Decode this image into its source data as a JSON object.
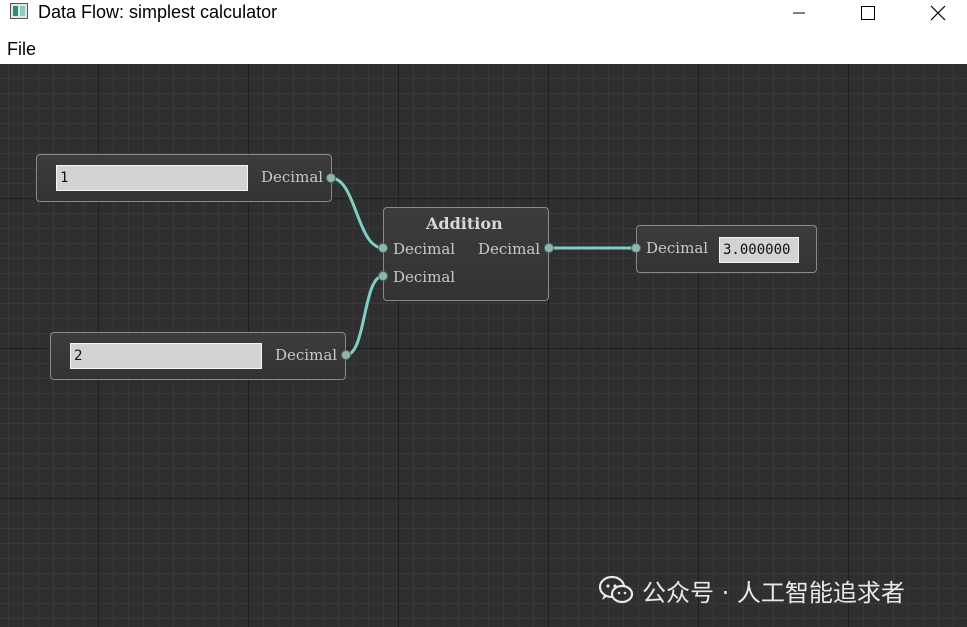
{
  "window": {
    "title": "Data Flow: simplest calculator",
    "icon": "app-window-icon"
  },
  "menu": {
    "file_label": "File"
  },
  "nodes": {
    "input1": {
      "value": "1",
      "out_port_label": "Decimal"
    },
    "input2": {
      "value": "2",
      "out_port_label": "Decimal"
    },
    "addition": {
      "title": "Addition",
      "in1_label": "Decimal",
      "in2_label": "Decimal",
      "out_label": "Decimal"
    },
    "result": {
      "in_port_label": "Decimal",
      "value": "3.000000"
    }
  },
  "colors": {
    "canvas_bg": "#2f2f2f",
    "wire": "#7fd0c4",
    "node_border": "#8a8a8a"
  },
  "watermark": {
    "text": "公众号 · 人工智能追求者",
    "icon": "wechat-icon"
  }
}
